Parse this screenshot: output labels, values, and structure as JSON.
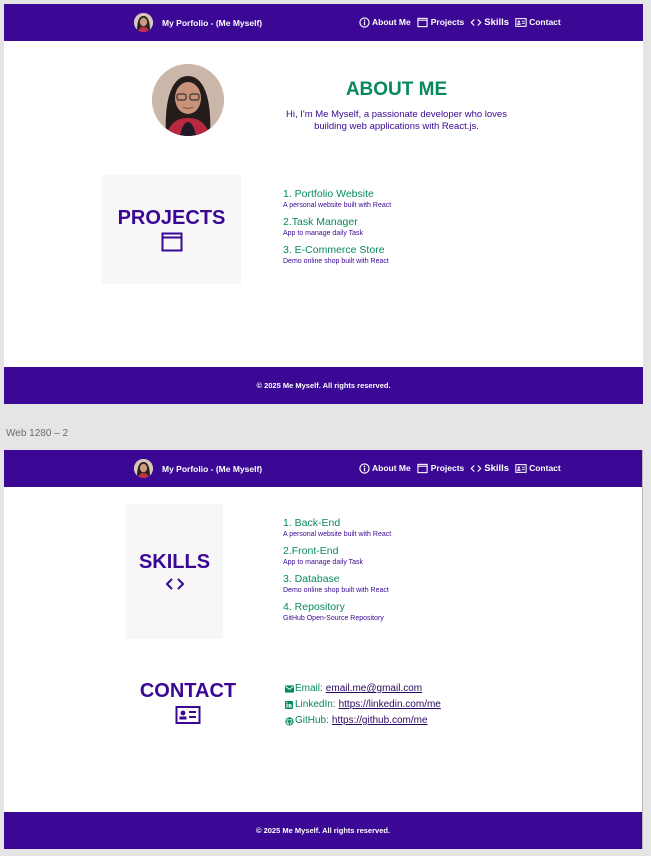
{
  "colors": {
    "brand": "#3a0894",
    "accent_green": "#078a5b",
    "card_bg": "#f7f7f7",
    "canvas_bg": "#e5e5e5"
  },
  "nav": {
    "brand_text": "My Porfolio - (Me Myself)",
    "links": [
      {
        "label": "About Me",
        "icon": "info-icon"
      },
      {
        "label": "Projects",
        "icon": "window-icon"
      },
      {
        "label": "Skills",
        "icon": "code-icon"
      },
      {
        "label": "Contact",
        "icon": "contact-card-icon"
      }
    ]
  },
  "frame2_label": "Web 1280 – 2",
  "about": {
    "title": "ABOUT ME",
    "text": "Hi, I'm Me Myself, a passionate developer who loves building web applications with React.js."
  },
  "projects": {
    "title": "PROJECTS",
    "icon": "window-icon",
    "items": [
      {
        "title": "1. Portfolio Website",
        "desc": "A personal website built with React"
      },
      {
        "title": "2.Task Manager",
        "desc": "App to manage daily Task"
      },
      {
        "title": "3. E-Commerce Store",
        "desc": "Demo online shop built with React"
      }
    ]
  },
  "skills": {
    "title": "SKILLS",
    "icon": "code-icon",
    "items": [
      {
        "title": "1. Back-End",
        "desc": "A personal website built with React"
      },
      {
        "title": "2.Front-End",
        "desc": "App to manage daily Task"
      },
      {
        "title": "3. Database",
        "desc": "Demo online shop built with React"
      },
      {
        "title": "4. Repository",
        "desc": "GitHub Open-Source Repository"
      }
    ]
  },
  "contact": {
    "title": "CONTACT",
    "icon": "contact-card-icon",
    "rows": [
      {
        "label": "Email:",
        "value": "email.me@gmail.com",
        "icon": "mail-icon"
      },
      {
        "label": "LinkedIn:",
        "value": "https://linkedin.com/me",
        "icon": "linkedin-icon"
      },
      {
        "label": "GitHub:",
        "value": "https://github.com/me",
        "icon": "github-icon"
      }
    ]
  },
  "footer": {
    "text": "© 2025 Me Myself. All rights reserved."
  }
}
